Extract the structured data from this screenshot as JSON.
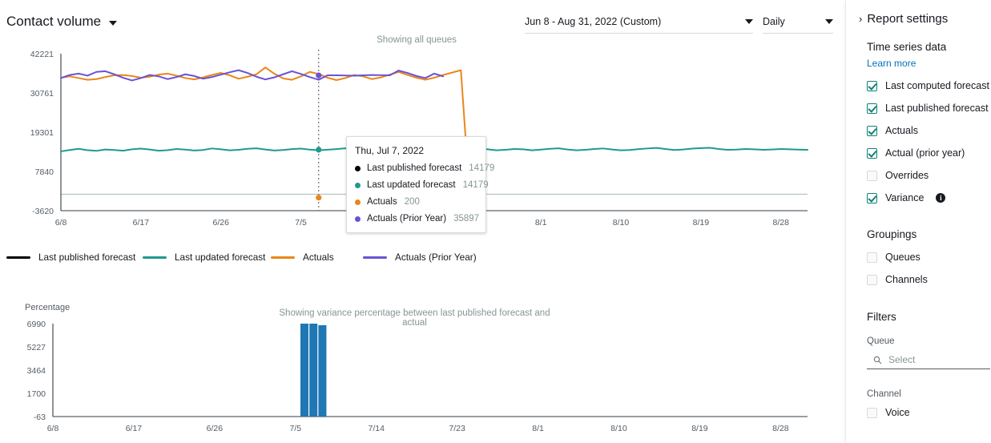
{
  "header": {
    "title": "Contact volume",
    "caret_icon": "chevron-down-icon",
    "date_range": "Jun 8 - Aug 31, 2022 (Custom)",
    "granularity": "Daily"
  },
  "top_chart_note": "Showing all queues",
  "bottom_chart_note": "Showing variance percentage between last published forecast and actual",
  "legend": [
    {
      "label": "Last published forecast",
      "color": "#000000"
    },
    {
      "label": "Last updated forecast",
      "color": "#1f9a8c"
    },
    {
      "label": "Actuals",
      "color": "#e8871a"
    },
    {
      "label": "Actuals (Prior Year)",
      "color": "#6b52d4"
    }
  ],
  "tooltip": {
    "date": "Thu, Jul 7, 2022",
    "rows": [
      {
        "name": "Last published forecast",
        "value": "14179",
        "color": "#000000"
      },
      {
        "name": "Last updated forecast",
        "value": "14179",
        "color": "#1f9a8c"
      },
      {
        "name": "Actuals",
        "value": "200",
        "color": "#e8871a"
      },
      {
        "name": "Actuals (Prior Year)",
        "value": "35897",
        "color": "#6b52d4"
      }
    ]
  },
  "panel": {
    "title": "Report settings",
    "chevron_icon": "chevron-right-icon",
    "time_series": {
      "heading": "Time series data",
      "learn_more": "Learn more",
      "items": [
        {
          "label": "Last computed forecast",
          "checked": true,
          "info": false
        },
        {
          "label": "Last published forecast",
          "checked": true,
          "info": false
        },
        {
          "label": "Actuals",
          "checked": true,
          "info": false
        },
        {
          "label": "Actual (prior year)",
          "checked": true,
          "info": false
        },
        {
          "label": "Overrides",
          "checked": false,
          "info": false
        },
        {
          "label": "Variance",
          "checked": true,
          "info": true
        }
      ]
    },
    "groupings": {
      "heading": "Groupings",
      "items": [
        {
          "label": "Queues",
          "checked": false
        },
        {
          "label": "Channels",
          "checked": false
        }
      ]
    },
    "filters": {
      "heading": "Filters",
      "queue_label": "Queue",
      "queue_placeholder": "Select",
      "search_icon": "search-icon",
      "channel_label": "Channel",
      "channel_items": [
        {
          "label": "Voice",
          "checked": false
        }
      ]
    }
  },
  "chart_data": [
    {
      "type": "line",
      "id": "contact-volume",
      "title": "",
      "subtitle": "Showing all queues",
      "xlabel": "",
      "ylabel": "",
      "ylim": [
        -3620,
        42221
      ],
      "yticks": [
        42221,
        30761,
        19301,
        7840,
        -3620
      ],
      "xticks": [
        "6/8",
        "6/17",
        "6/26",
        "7/5",
        "7/14",
        "7/23",
        "8/1",
        "8/10",
        "8/19",
        "8/28"
      ],
      "x_domain": [
        "2022-06-08",
        "2022-08-31"
      ],
      "grid": false,
      "legend_position": "bottom",
      "cursor_date": "2022-07-07",
      "series": [
        {
          "name": "Last published forecast",
          "color": "#000000",
          "values": []
        },
        {
          "name": "Last updated forecast",
          "color": "#1f9a8c",
          "values": [
            13700,
            14100,
            14450,
            14050,
            13850,
            14250,
            14100,
            13900,
            14300,
            14500,
            14250,
            13900,
            14050,
            14400,
            14200,
            13950,
            14100,
            14550,
            14300,
            14000,
            14150,
            14450,
            14600,
            14250,
            13950,
            14100,
            14350,
            14500,
            14200,
            14000,
            14179,
            14350,
            14600,
            14250,
            14000,
            14150,
            14400,
            14550,
            14250,
            13950,
            14100,
            14350,
            14500,
            14200,
            14050,
            14200,
            14450,
            14600,
            14300,
            14000,
            14150,
            14400,
            14300,
            14000,
            14200,
            14450,
            14600,
            14250,
            14000,
            14150,
            14400,
            14550,
            14250,
            14000,
            14100,
            14350,
            14550,
            14700,
            14400,
            14100,
            14250,
            14500,
            14650,
            14750,
            14400,
            14150,
            14200,
            14400,
            14300,
            14150,
            14250,
            14400,
            14300,
            14200,
            14150
          ]
        },
        {
          "name": "Actuals",
          "color": "#e8871a",
          "values": [
            35200,
            35600,
            35100,
            34600,
            34800,
            35400,
            35900,
            36000,
            35700,
            35200,
            35500,
            36100,
            36400,
            35800,
            35100,
            34700,
            35300,
            36000,
            36600,
            35900,
            34900,
            35500,
            36200,
            38200,
            36400,
            35000,
            34600,
            35600,
            36900,
            36300,
            35200,
            34500,
            35100,
            36000,
            35600,
            34800,
            35300,
            36100,
            36900,
            36000,
            35200,
            34600,
            35200,
            36000,
            36700,
            37400,
            200,
            200
          ]
        },
        {
          "name": "Actuals (Prior Year)",
          "color": "#6b52d4",
          "values": [
            35100,
            36000,
            36400,
            35800,
            36900,
            37100,
            36200,
            35200,
            34400,
            35100,
            36000,
            35600,
            34800,
            35400,
            36200,
            35700,
            34900,
            35400,
            36100,
            36800,
            37400,
            36600,
            35500,
            34700,
            35300,
            36200,
            37100,
            36300,
            35400,
            34600,
            35897,
            35900,
            35850,
            35800,
            35900,
            36000,
            35950,
            35900,
            37300,
            36600,
            35700,
            35100,
            36400,
            35600
          ]
        }
      ]
    },
    {
      "type": "bar",
      "id": "variance-percentage",
      "title": "",
      "subtitle": "Showing variance percentage between last published forecast and actual",
      "xlabel": "",
      "ylabel": "Percentage",
      "ylim": [
        -63,
        6990
      ],
      "yticks": [
        6990,
        5227,
        3464,
        1700,
        -63
      ],
      "xticks": [
        "6/8",
        "6/17",
        "6/26",
        "7/5",
        "7/14",
        "7/23",
        "8/1",
        "8/10",
        "8/19",
        "8/28"
      ],
      "grid": false,
      "bar_color": "#1f77b4",
      "categories": [
        "7/6",
        "7/7",
        "7/8"
      ],
      "values": [
        6990,
        6990,
        6870
      ]
    }
  ]
}
